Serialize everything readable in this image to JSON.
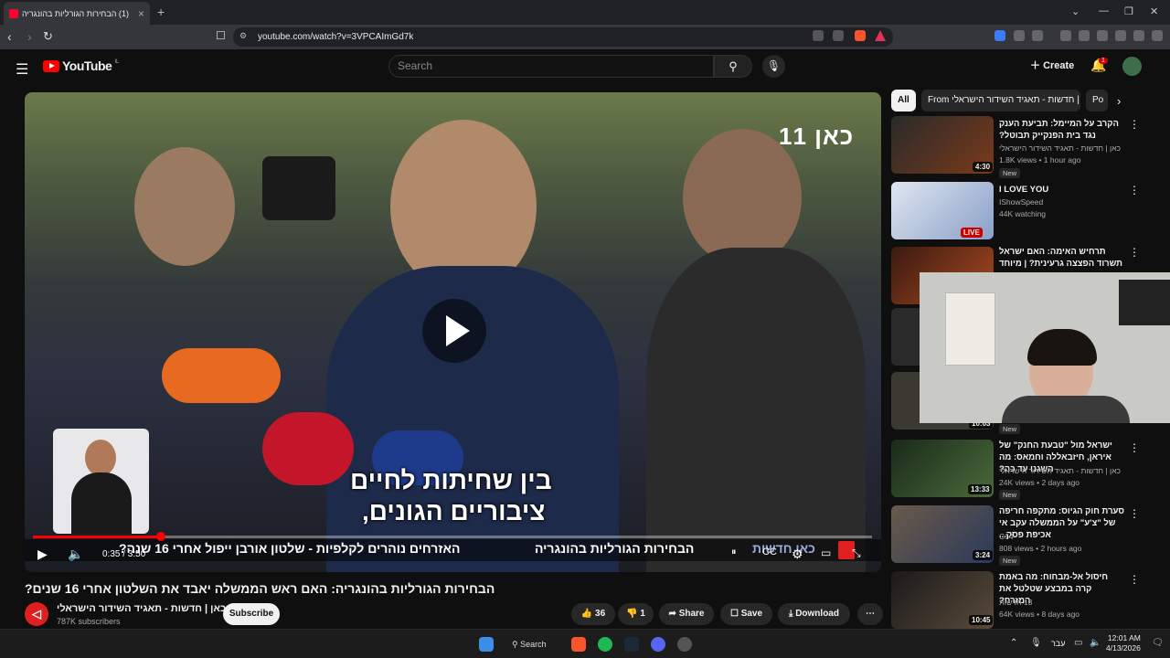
{
  "browser": {
    "tab_title": "(1) הבחירות הגורליות בהונגריה",
    "url": "youtube.com/watch?v=3VPCAImGd7k"
  },
  "youtube": {
    "logo_text": "YouTube",
    "logo_region": "IL",
    "search_placeholder": "Search",
    "create_label": "Create",
    "notification_count": "1"
  },
  "video": {
    "channel_logo": "כאן 11",
    "subtitle_line1": "בין שחיתות לחיים",
    "subtitle_line2": "ציבוריים הגונים,",
    "ticker_brand": "כאן חדשות",
    "ticker_headline": "הבחירות הגורליות בהונגריה",
    "ticker_text": "האזרחים נוהרים לקלפיות - שלטון אורבן ייפול אחרי 16 שנה?",
    "time": "0:35 / 3:50",
    "progress_fraction": 0.152,
    "title": "הבחירות הגורליות בהונגריה: האם ראש הממשלה יאבד את השלטון אחרי 16 שנים?",
    "channel_name": "כאן | חדשות - תאגיד השידור הישראלי",
    "subscribers": "787K subscribers",
    "subscribe_label": "Subscribe",
    "likes": "36",
    "dislikes": "1",
    "share_label": "Share",
    "save_label": "Save",
    "download_label": "Download"
  },
  "chips": [
    "All",
    "From כאן | חדשות - תאגיד השידור הישראלי",
    "Po"
  ],
  "sidebar": [
    {
      "title": "הקרב על המיימל: תביעת הענק נגד בית הפנקייק תבוטל?",
      "channel": "כאן | חדשות - תאגיד השידור הישראלי",
      "meta": "1.8K views • 1 hour ago",
      "badge": "New",
      "duration": "4:30"
    },
    {
      "title": "I LOVE YOU",
      "channel": "IShowSpeed",
      "meta": "44K watching",
      "badge": "",
      "duration": "LIVE"
    },
    {
      "title": "תרחיש האימה: האם ישראל תשרוד הפצצה גרעינית? | מיוחד",
      "channel": "",
      "meta": "",
      "badge": "",
      "duration": ""
    },
    {
      "title": "",
      "channel": "",
      "meta": "",
      "badge": "New",
      "duration": "10:03"
    },
    {
      "title": "ישראל מול \"טבעת החנק\" של איראן, חיזבאללה וחמאס: מה השגנו עד כה?",
      "channel": "כאן | חדשות - תאגיד השידור הישראלי",
      "meta": "24K views • 2 days ago",
      "badge": "New",
      "duration": "13:33"
    },
    {
      "title": "סערת חוק הגיוס: מתקפה חריפה של \"צ'ע\" על הממשלה עקב אי אכיפת פסק...",
      "channel": "C14",
      "meta": "808 views • 2 hours ago",
      "badge": "New",
      "duration": "3:24"
    },
    {
      "title": "חיסול אל-מבחוח: מה באמת קרה במבצע שטלטל את המזרח?",
      "channel": "13 חדשות",
      "meta": "64K views • 8 days ago",
      "badge": "",
      "duration": "10:45"
    }
  ],
  "taskbar": {
    "search_label": "Search",
    "language": "עבר",
    "time": "12:01 AM",
    "date": "4/13/2026"
  }
}
